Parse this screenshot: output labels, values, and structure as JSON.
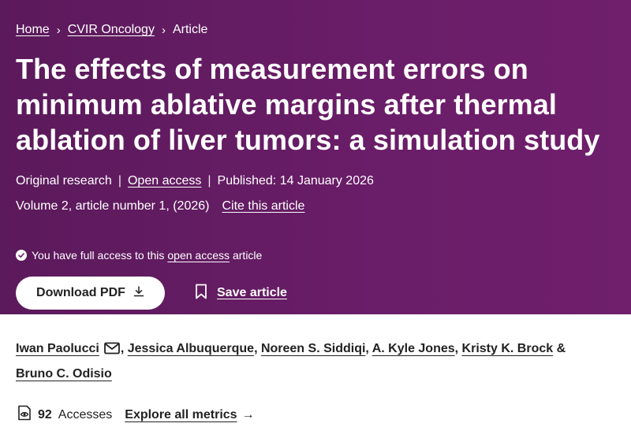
{
  "breadcrumb": {
    "items": [
      "Home",
      "CVIR Oncology"
    ],
    "current": "Article"
  },
  "article": {
    "title": "The effects of measurement errors on minimum ablative margins after thermal ablation of liver tumors: a simulation study",
    "type": "Original research",
    "open_access": "Open access",
    "published": "Published: 14 January 2026",
    "volume": "Volume 2, article number 1, (2026)",
    "cite": "Cite this article"
  },
  "access": {
    "prefix": "You have full access to this",
    "link": "open access",
    "suffix": "article"
  },
  "actions": {
    "download_pdf": "Download PDF",
    "save_article": "Save article"
  },
  "authors": [
    "Iwan Paolucci",
    "Jessica Albuquerque",
    "Noreen S. Siddiqi",
    "A. Kyle Jones",
    "Kristy K. Brock",
    "Bruno C. Odisio"
  ],
  "metrics": {
    "count": "92",
    "label": "Accesses",
    "explore": "Explore all metrics"
  },
  "colors": {
    "hero_background": "#6a1d68",
    "text": "#222222"
  }
}
